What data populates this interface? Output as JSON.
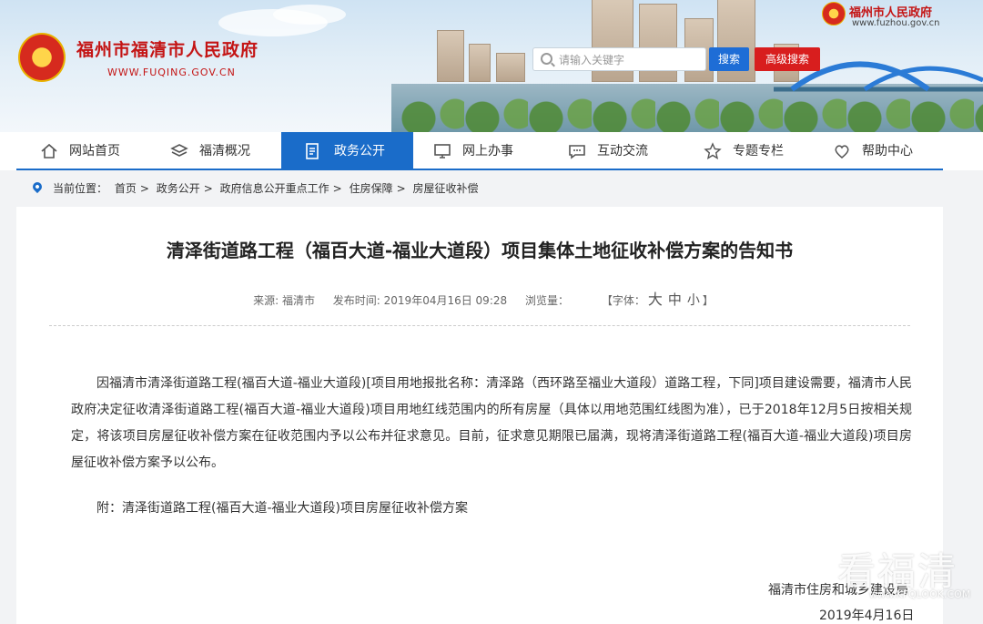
{
  "header": {
    "site_title": "福州市福清市人民政府",
    "site_url": "WWW.FUQING.GOV.CN",
    "parent_site_title": "福州市人民政府",
    "parent_site_url": "www.fuzhou.gov.cn",
    "search": {
      "placeholder": "请输入关键字",
      "value": "",
      "search_label": "搜索",
      "advanced_label": "高级搜索"
    }
  },
  "nav": {
    "items": [
      {
        "label": "网站首页",
        "icon": "home-icon",
        "active": false
      },
      {
        "label": "福清概况",
        "icon": "layers-icon",
        "active": false
      },
      {
        "label": "政务公开",
        "icon": "document-icon",
        "active": true
      },
      {
        "label": "网上办事",
        "icon": "monitor-icon",
        "active": false
      },
      {
        "label": "互动交流",
        "icon": "chat-icon",
        "active": false
      },
      {
        "label": "专题专栏",
        "icon": "star-icon",
        "active": false
      },
      {
        "label": "帮助中心",
        "icon": "help-icon",
        "active": false
      }
    ],
    "active_color": "#1a6cc9"
  },
  "breadcrumb": {
    "prefix": "当前位置：",
    "items": [
      "首页",
      "政务公开",
      "政府信息公开重点工作",
      "住房保障",
      "房屋征收补偿"
    ],
    "separator": ">"
  },
  "article": {
    "title": "清泽街道路工程（福百大道-福业大道段）项目集体土地征收补偿方案的告知书",
    "source": "来源: 福清市",
    "publish_time": "发布时间: 2019年04月16日 09:28",
    "views": "浏览量：",
    "font_label_open": "【字体：",
    "font_large": "大",
    "font_medium": "中",
    "font_small": "小",
    "font_label_close": "】",
    "body": "因福清市清泽街道路工程(福百大道-福业大道段)[项目用地报批名称：清泽路（西环路至福业大道段）道路工程，下同]项目建设需要，福清市人民政府决定征收清泽街道路工程(福百大道-福业大道段)项目用地红线范围内的所有房屋（具体以用地范围红线图为准），已于2018年12月5日按相关规定，将该项目房屋征收补偿方案在征收范围内予以公布并征求意见。目前，征求意见期限已届满，现将清泽街道路工程(福百大道-福业大道段)项目房屋征收补偿方案予以公布。",
    "attachment": "附：清泽街道路工程(福百大道-福业大道段)项目房屋征收补偿方案",
    "signature": "福清市住房和城乡建设局",
    "sign_date": "2019年4月16日"
  },
  "watermark": {
    "text": "看福清",
    "url": "www.KFQLOOK.COM"
  }
}
